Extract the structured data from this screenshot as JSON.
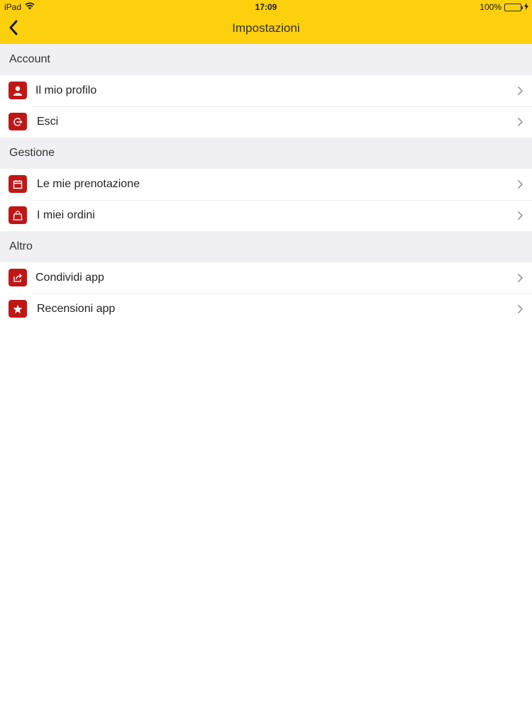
{
  "status_bar": {
    "carrier": "iPad",
    "time": "17:09",
    "battery": "100%"
  },
  "nav": {
    "title": "Impostazioni",
    "back_icon": "chevron-left-icon"
  },
  "sections": [
    {
      "header": "Account",
      "items": [
        {
          "label": "Il mio profilo",
          "icon": "user-icon"
        },
        {
          "label": "Esci",
          "icon": "logout-icon"
        }
      ]
    },
    {
      "header": "Gestione",
      "items": [
        {
          "label": "Le mie prenotazione",
          "icon": "calendar-icon"
        },
        {
          "label": "I miei ordini",
          "icon": "bag-icon"
        }
      ]
    },
    {
      "header": "Altro",
      "items": [
        {
          "label": "Condividi app",
          "icon": "share-icon"
        },
        {
          "label": "Recensioni app",
          "icon": "star-icon"
        }
      ]
    }
  ],
  "colors": {
    "navbar": "#fdd00e",
    "icon_bg": "#c11616",
    "section_bg": "#efeff4"
  }
}
